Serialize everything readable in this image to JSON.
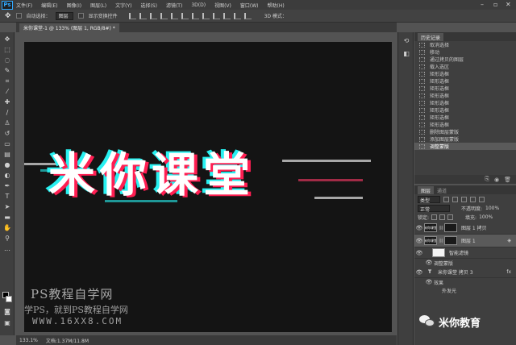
{
  "app": {
    "logo": "Ps"
  },
  "menu": [
    "文件(F)",
    "编辑(E)",
    "图像(I)",
    "图层(L)",
    "文字(Y)",
    "选择(S)",
    "滤镜(T)",
    "3D(D)",
    "视图(V)",
    "窗口(W)",
    "帮助(H)"
  ],
  "options": {
    "auto_select_label": "自动选择：",
    "auto_select_value": "图层",
    "show_transform_label": "显示变换控件",
    "mode_3d_label": "3D 模式："
  },
  "document": {
    "tab_title": "米你课堂-1 @ 133% (图层 1, RGB/8#) *",
    "artwork_text": "米你课堂"
  },
  "watermark": {
    "title": "PS教程自学网",
    "subtitle": "学PS，就到PS教程自学网",
    "url": "WWW.16XX8.COM"
  },
  "status": {
    "zoom": "133.1%",
    "doc_info": "文档:1.37M/11.8M"
  },
  "history": {
    "tabs": [
      "历史记录"
    ],
    "items": [
      "取消选择",
      "移动",
      "通过拷贝的图层",
      "载入选区",
      "矩形选框",
      "矩形选框",
      "矩形选框",
      "矩形选框",
      "矩形选框",
      "矩形选框",
      "矩形选框",
      "矩形选框",
      "删除图层蒙版",
      "添加图层蒙版",
      "调整蒙版"
    ],
    "active_index": 14
  },
  "layers": {
    "tabs": [
      "图层",
      "通道"
    ],
    "filter_kind": "类型",
    "blend_mode": "正常",
    "opacity_label": "不透明度:",
    "opacity_value": "100%",
    "lock_label": "锁定:",
    "fill_label": "填充:",
    "fill_value": "100%",
    "rows": [
      {
        "name": "图层 1 拷贝",
        "thumb_text": "米你课堂",
        "selected": false
      },
      {
        "name": "图层 1",
        "thumb_text": "米你课堂",
        "selected": true
      }
    ],
    "smart_filters_label": "智能滤镜",
    "filter_item": "调整蒙版",
    "text_layer_name": "米你课堂 拷贝 3",
    "effects_label": "效果",
    "stroke_label": "外发光"
  },
  "wechat": {
    "name": "米你教育"
  },
  "icons": {
    "eye": "eye-icon",
    "wechat": "wechat-icon",
    "brush": "brush-icon"
  }
}
